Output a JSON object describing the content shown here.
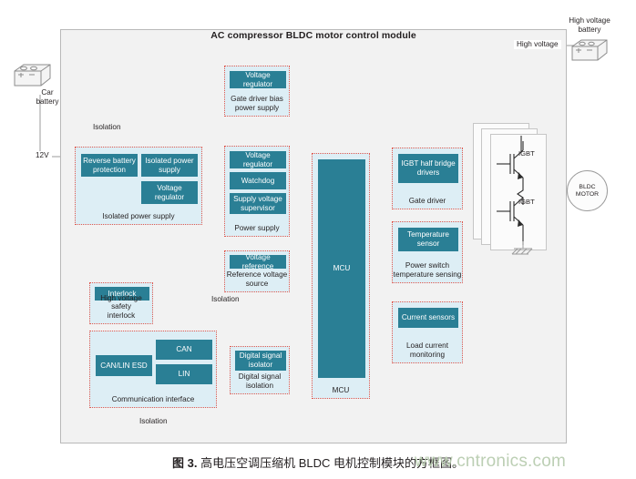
{
  "module": {
    "title": "AC compressor BLDC motor control module"
  },
  "external": {
    "car_battery_label": "Car\nbattery",
    "car_battery_line1": "Car",
    "car_battery_line2": "battery",
    "voltage_12v": "12V",
    "hv_battery_line1": "High voltage",
    "hv_battery_line2": "battery",
    "high_voltage_label": "High voltage",
    "car_battery_icon": "battery-icon",
    "hv_battery_icon": "battery-icon"
  },
  "isolation_labels": {
    "top_left": "Isolation",
    "middle": "Isolation",
    "bottom": "Isolation"
  },
  "groups": [
    {
      "id": "gate-driver-bias",
      "caption": "Gate driver bias\npower supply",
      "caption_line1": "Gate driver bias",
      "caption_line2": "power supply",
      "blocks": [
        {
          "label": "Voltage regulator"
        }
      ]
    },
    {
      "id": "isolated-power-supply",
      "caption": "Isolated power supply",
      "blocks": [
        {
          "label": "Reverse battery\nprotection",
          "line1": "Reverse battery",
          "line2": "protection"
        },
        {
          "label": "Isolated power\nsupply",
          "line1": "Isolated power",
          "line2": "supply"
        },
        {
          "label": "Voltage\nregulator",
          "line1": "Voltage",
          "line2": "regulator"
        }
      ]
    },
    {
      "id": "power-supply",
      "caption": "Power supply",
      "blocks": [
        {
          "label": "Voltage regulator"
        },
        {
          "label": "Watchdog"
        },
        {
          "label": "Supply voltage\nsupervisor",
          "line1": "Supply voltage",
          "line2": "supervisor"
        }
      ]
    },
    {
      "id": "reference-voltage-source",
      "caption": "Reference voltage\nsource",
      "caption_line1": "Reference voltage",
      "caption_line2": "source",
      "blocks": [
        {
          "label": "Voltage reference"
        }
      ]
    },
    {
      "id": "high-voltage-safety-interlock",
      "caption": "High voltage safety\ninterlock",
      "caption_line1": "High voltage safety",
      "caption_line2": "interlock",
      "blocks": [
        {
          "label": "Interlock"
        }
      ]
    },
    {
      "id": "communication-interface",
      "caption": "Communication interface",
      "blocks": [
        {
          "label": "CAN/LIN ESD"
        },
        {
          "label": "CAN"
        },
        {
          "label": "LIN"
        }
      ]
    },
    {
      "id": "digital-signal-isolation",
      "caption": "Digital signal\nisolation",
      "caption_line1": "Digital signal",
      "caption_line2": "isolation",
      "blocks": [
        {
          "label": "Digital signal\nisolator",
          "line1": "Digital signal",
          "line2": "isolator"
        }
      ]
    },
    {
      "id": "mcu",
      "caption": "MCU",
      "blocks": [
        {
          "label": "MCU"
        }
      ]
    },
    {
      "id": "gate-driver",
      "caption": "Gate driver",
      "blocks": [
        {
          "label": "IGBT half bridge\ndrivers",
          "line1": "IGBT half bridge",
          "line2": "drivers"
        }
      ]
    },
    {
      "id": "power-switch-temperature-sensing",
      "caption": "Power switch\ntemperature sensing",
      "caption_line1": "Power switch",
      "caption_line2": "temperature sensing",
      "blocks": [
        {
          "label": "Temperature\nsensor",
          "line1": "Temperature",
          "line2": "sensor"
        }
      ]
    },
    {
      "id": "load-current-monitoring",
      "caption": "Load current\nmonitoring",
      "caption_line1": "Load current",
      "caption_line2": "monitoring",
      "blocks": [
        {
          "label": "Current sensors"
        }
      ]
    }
  ],
  "power_stage": {
    "igbt_top_label": "IGBT",
    "igbt_bottom_label": "IGBT"
  },
  "motor": {
    "line1": "BLDC",
    "line2": "MOTOR"
  },
  "caption": {
    "figure_number": "图 3.",
    "text": " 高电压空调压缩机 BLDC 电机控制模块的方框图。",
    "watermark": "www.cntronics.com"
  },
  "colors": {
    "teal": "#2a7f95",
    "light_blue": "#ddeef5",
    "dotted_border": "#e2584d",
    "module_bg": "#f2f2f2",
    "line": "#9b9b9b"
  }
}
